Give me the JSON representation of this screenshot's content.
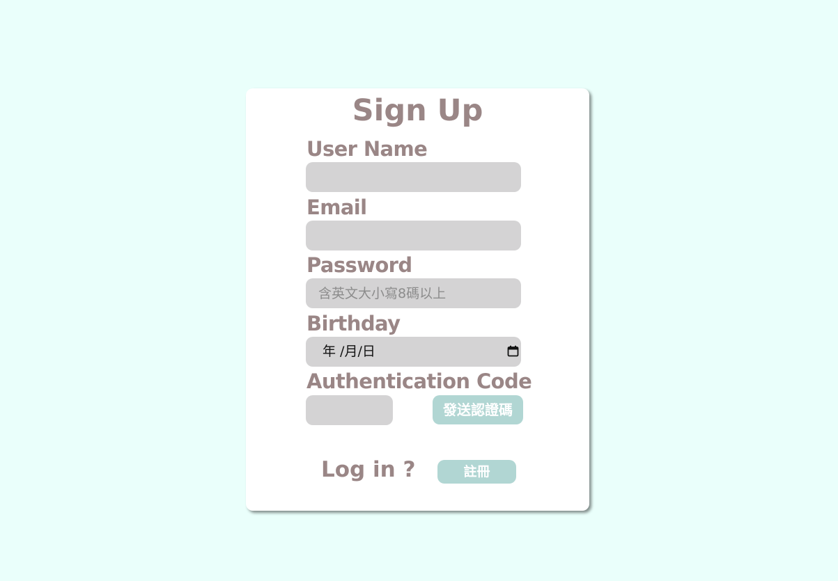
{
  "form": {
    "title": "Sign Up",
    "username": {
      "label": "User Name",
      "value": "",
      "placeholder": ""
    },
    "email": {
      "label": "Email",
      "value": "",
      "placeholder": ""
    },
    "password": {
      "label": "Password",
      "value": "",
      "placeholder": "含英文大小寫8碼以上"
    },
    "birthday": {
      "label": "Birthday",
      "display": "年 /月/日",
      "icon": "calendar-icon"
    },
    "auth_code": {
      "label": "Authentication Code",
      "value": "",
      "send_button": "發送認證碼"
    },
    "login_link": "Log in ?",
    "register_button": "註冊"
  },
  "colors": {
    "background": "#eafffb",
    "card": "#ffffff",
    "label_text": "#9a8686",
    "input_bg": "#d4d3d4",
    "button_bg": "#b1d6d3",
    "button_text": "#ffffff"
  }
}
